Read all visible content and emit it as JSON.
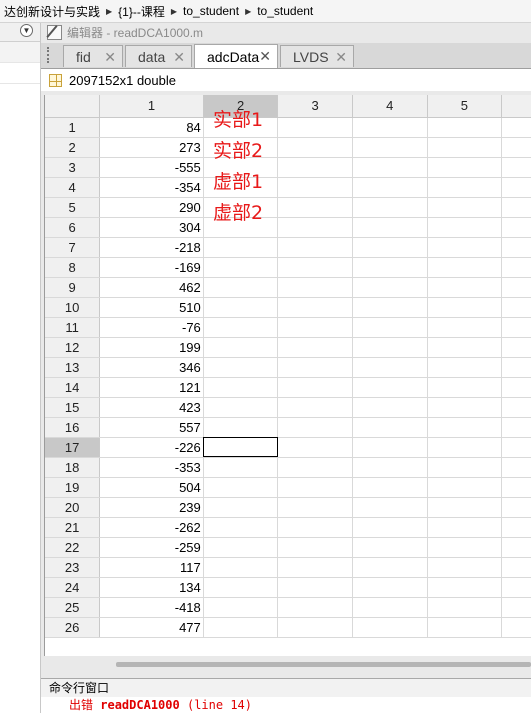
{
  "breadcrumb": [
    "达创新设计与实践",
    "{1}--课程",
    "to_student",
    "to_student"
  ],
  "editor": {
    "title": "编辑器 - readDCA1000.m"
  },
  "tabs": [
    {
      "label": "fid",
      "active": false
    },
    {
      "label": "data",
      "active": false
    },
    {
      "label": "adcData",
      "active": true
    },
    {
      "label": "LVDS",
      "active": false
    }
  ],
  "variable": {
    "size": "2097152x1 double"
  },
  "grid": {
    "columns": [
      "1",
      "2",
      "3",
      "4",
      "5"
    ],
    "selected_column": "2",
    "selected_row": "17",
    "rows": [
      {
        "idx": "1",
        "v": "84"
      },
      {
        "idx": "2",
        "v": "273"
      },
      {
        "idx": "3",
        "v": "-555"
      },
      {
        "idx": "4",
        "v": "-354"
      },
      {
        "idx": "5",
        "v": "290"
      },
      {
        "idx": "6",
        "v": "304"
      },
      {
        "idx": "7",
        "v": "-218"
      },
      {
        "idx": "8",
        "v": "-169"
      },
      {
        "idx": "9",
        "v": "462"
      },
      {
        "idx": "10",
        "v": "510"
      },
      {
        "idx": "11",
        "v": "-76"
      },
      {
        "idx": "12",
        "v": "199"
      },
      {
        "idx": "13",
        "v": "346"
      },
      {
        "idx": "14",
        "v": "121"
      },
      {
        "idx": "15",
        "v": "423"
      },
      {
        "idx": "16",
        "v": "557"
      },
      {
        "idx": "17",
        "v": "-226"
      },
      {
        "idx": "18",
        "v": "-353"
      },
      {
        "idx": "19",
        "v": "504"
      },
      {
        "idx": "20",
        "v": "239"
      },
      {
        "idx": "21",
        "v": "-262"
      },
      {
        "idx": "22",
        "v": "-259"
      },
      {
        "idx": "23",
        "v": "117"
      },
      {
        "idx": "24",
        "v": "134"
      },
      {
        "idx": "25",
        "v": "-418"
      },
      {
        "idx": "26",
        "v": "477"
      }
    ]
  },
  "annotations": [
    "实部1",
    "实部2",
    "虚部1",
    "虚部2"
  ],
  "annotation_color": "#e81919",
  "command_window": {
    "title": "命令行窗口",
    "error_prefix": "出错",
    "error_function": "readDCA1000",
    "error_location": "(line 14)"
  }
}
